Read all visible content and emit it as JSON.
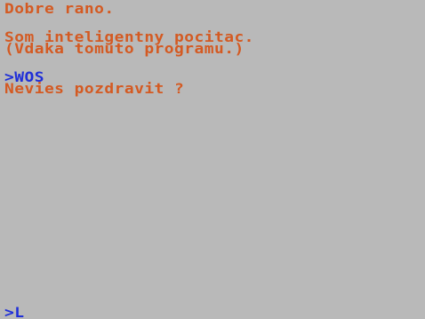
{
  "colors": {
    "background": "#b9b9b9",
    "output_text": "#d45a22",
    "input_text": "#1f2fd8"
  },
  "terminal": {
    "lines": [
      {
        "kind": "output",
        "text": "Dobre rano."
      },
      {
        "kind": "output",
        "text": "Som inteligentny pocitac."
      },
      {
        "kind": "output",
        "text": "(Vdaka tomuto programu.)"
      },
      {
        "kind": "input",
        "text": ">WOS"
      },
      {
        "kind": "output",
        "text": "Nevies pozdravit ?"
      }
    ],
    "prompt": {
      "symbol": ">",
      "cursor": "L"
    }
  }
}
